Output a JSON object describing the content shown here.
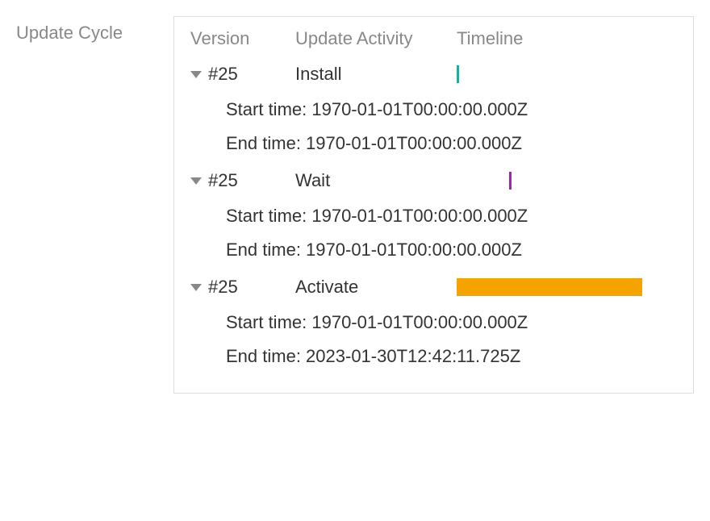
{
  "section_title": "Update Cycle",
  "columns": {
    "version": "Version",
    "activity": "Update Activity",
    "timeline": "Timeline"
  },
  "labels": {
    "start_time": "Start time: ",
    "end_time": "End time: "
  },
  "entries": [
    {
      "version": "#25",
      "activity": "Install",
      "bar_class": "bar-install",
      "start_time": "1970-01-01T00:00:00.000Z",
      "end_time": "1970-01-01T00:00:00.000Z"
    },
    {
      "version": "#25",
      "activity": "Wait",
      "bar_class": "bar-wait",
      "start_time": "1970-01-01T00:00:00.000Z",
      "end_time": "1970-01-01T00:00:00.000Z"
    },
    {
      "version": "#25",
      "activity": "Activate",
      "bar_class": "bar-activate",
      "start_time": "1970-01-01T00:00:00.000Z",
      "end_time": "2023-01-30T12:42:11.725Z"
    }
  ]
}
